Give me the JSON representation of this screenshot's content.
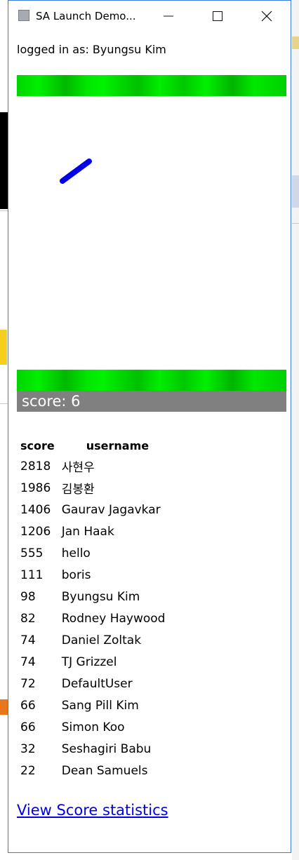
{
  "window": {
    "title": "SA Launch Demo..."
  },
  "header": {
    "logged_in_text": "logged in as: Byungsu Kim"
  },
  "game": {
    "score_text": "score: 6",
    "paddle_color": "#0000e6",
    "bar_color": "#00dd00",
    "score_band_color": "#808080"
  },
  "leaderboard": {
    "columns": [
      "score",
      "username"
    ],
    "rows": [
      {
        "score": "2818",
        "username": "사현우"
      },
      {
        "score": "1986",
        "username": "김봉환"
      },
      {
        "score": "1406",
        "username": "Gaurav Jagavkar"
      },
      {
        "score": "1206",
        "username": "Jan Haak"
      },
      {
        "score": "555",
        "username": "hello"
      },
      {
        "score": "111",
        "username": "boris"
      },
      {
        "score": "98",
        "username": "Byungsu Kim"
      },
      {
        "score": "82",
        "username": "Rodney Haywood"
      },
      {
        "score": "74",
        "username": "Daniel Zoltak"
      },
      {
        "score": "74",
        "username": "TJ Grizzel"
      },
      {
        "score": "72",
        "username": "DefaultUser"
      },
      {
        "score": "66",
        "username": "Sang Pill Kim"
      },
      {
        "score": "66",
        "username": "Simon Koo"
      },
      {
        "score": "32",
        "username": "Seshagiri Babu"
      },
      {
        "score": "22",
        "username": "Dean Samuels"
      }
    ]
  },
  "footer": {
    "stats_link": "View Score statistics"
  },
  "icons": {
    "app": "app-icon",
    "minimize": "minimize-icon",
    "maximize": "maximize-icon",
    "close": "close-icon"
  }
}
